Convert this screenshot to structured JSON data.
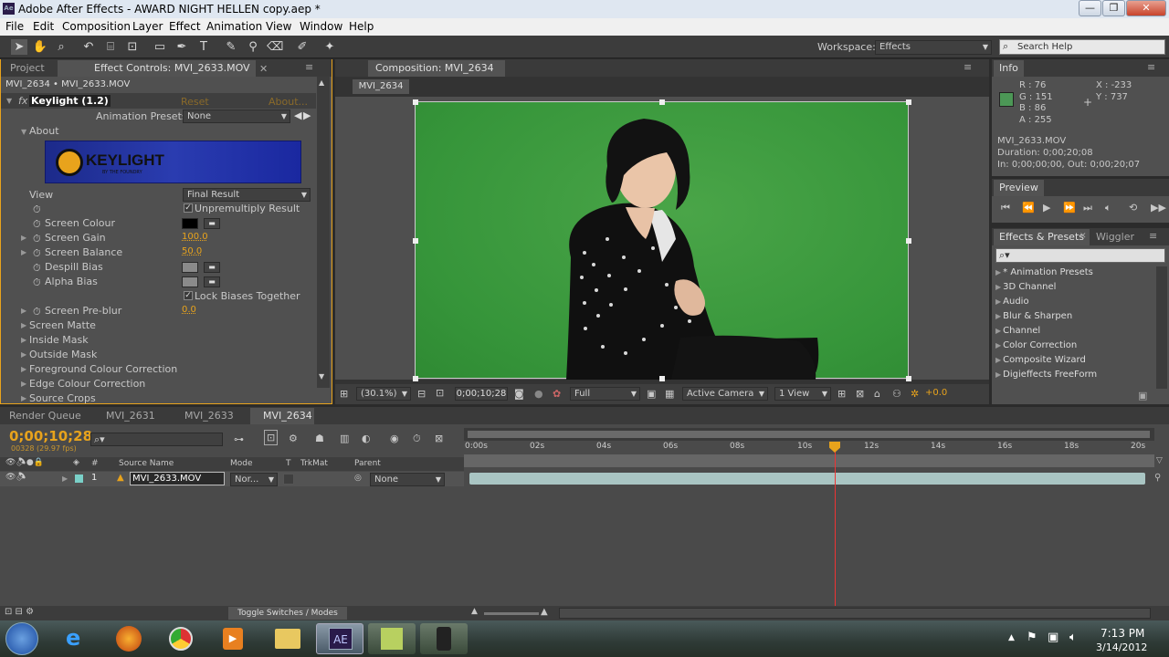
{
  "window": {
    "title": "Adobe After Effects - AWARD NIGHT HELLEN copy.aep *",
    "min": "—",
    "max": "❐",
    "close": "✕"
  },
  "menu": [
    "File",
    "Edit",
    "Composition",
    "Layer",
    "Effect",
    "Animation",
    "View",
    "Window",
    "Help"
  ],
  "toolbar": {
    "workspace_label": "Workspace:",
    "workspace_value": "Effects",
    "search_placeholder": "Search Help"
  },
  "left_panel": {
    "tab_project": "Project",
    "tab_effect": "Effect Controls: MVI_2633.MOV",
    "breadcrumb": "MVI_2634 • MVI_2633.MOV",
    "effect_name": "Keylight (1.2)",
    "reset": "Reset",
    "about": "About...",
    "anim_presets_label": "Animation Presets:",
    "anim_presets_value": "None",
    "about_group": "About",
    "logo_text": "KEYLIGHT",
    "logo_sub": "BY THE FOUNDRY",
    "view_label": "View",
    "view_value": "Final Result",
    "unpremultiply": "Unpremultiply Result",
    "screen_colour": "Screen Colour",
    "screen_gain": "Screen Gain",
    "screen_gain_val": "100.0",
    "screen_balance": "Screen Balance",
    "screen_balance_val": "50.0",
    "despill_bias": "Despill Bias",
    "alpha_bias": "Alpha Bias",
    "lock_biases": "Lock Biases Together",
    "screen_preblur": "Screen Pre-blur",
    "screen_preblur_val": "0.0",
    "groups": [
      "Screen Matte",
      "Inside Mask",
      "Outside Mask",
      "Foreground Colour Correction",
      "Edge Colour Correction",
      "Source Crops"
    ]
  },
  "comp": {
    "tab": "Composition: MVI_2634",
    "sub_tab": "MVI_2634",
    "zoom": "(30.1%)",
    "time": "0;00;10;28",
    "resolution": "Full",
    "camera": "Active Camera",
    "views": "1 View",
    "exposure": "+0.0"
  },
  "info": {
    "tab": "Info",
    "r": "R : 76",
    "g": "G : 151",
    "b": "B : 86",
    "a": "A : 255",
    "x": "X : -233",
    "y": "Y : 737",
    "file": "MVI_2633.MOV",
    "duration": "Duration: 0;00;20;08",
    "inout": "In: 0;00;00;00, Out: 0;00;20;07",
    "swatch": "#4c9756"
  },
  "preview": {
    "tab": "Preview"
  },
  "effects_presets": {
    "tab": "Effects & Presets",
    "tab2": "Wiggler",
    "search_placeholder": "",
    "items": [
      "* Animation Presets",
      "3D Channel",
      "Audio",
      "Blur & Sharpen",
      "Channel",
      "Color Correction",
      "Composite Wizard",
      "Digieffects FreeForm"
    ]
  },
  "timeline": {
    "tabs": [
      "Render Queue",
      "MVI_2631",
      "MVI_2633",
      "MVI_2634"
    ],
    "timecode": "0;00;10;28",
    "frames": "00328 (29.97 fps)",
    "cols": {
      "hash": "#",
      "source": "Source Name",
      "mode": "Mode",
      "t": "T",
      "trkmat": "TrkMat",
      "parent": "Parent"
    },
    "layer": {
      "num": "1",
      "name": "MVI_2633.MOV",
      "mode": "Nor...",
      "parent": "None"
    },
    "ticks": [
      "0:00s",
      "02s",
      "04s",
      "06s",
      "08s",
      "10s",
      "12s",
      "14s",
      "16s",
      "18s",
      "20s"
    ],
    "toggle": "Toggle Switches / Modes"
  },
  "taskbar": {
    "time": "7:13 PM",
    "date": "3/14/2012",
    "ae": "AE"
  }
}
